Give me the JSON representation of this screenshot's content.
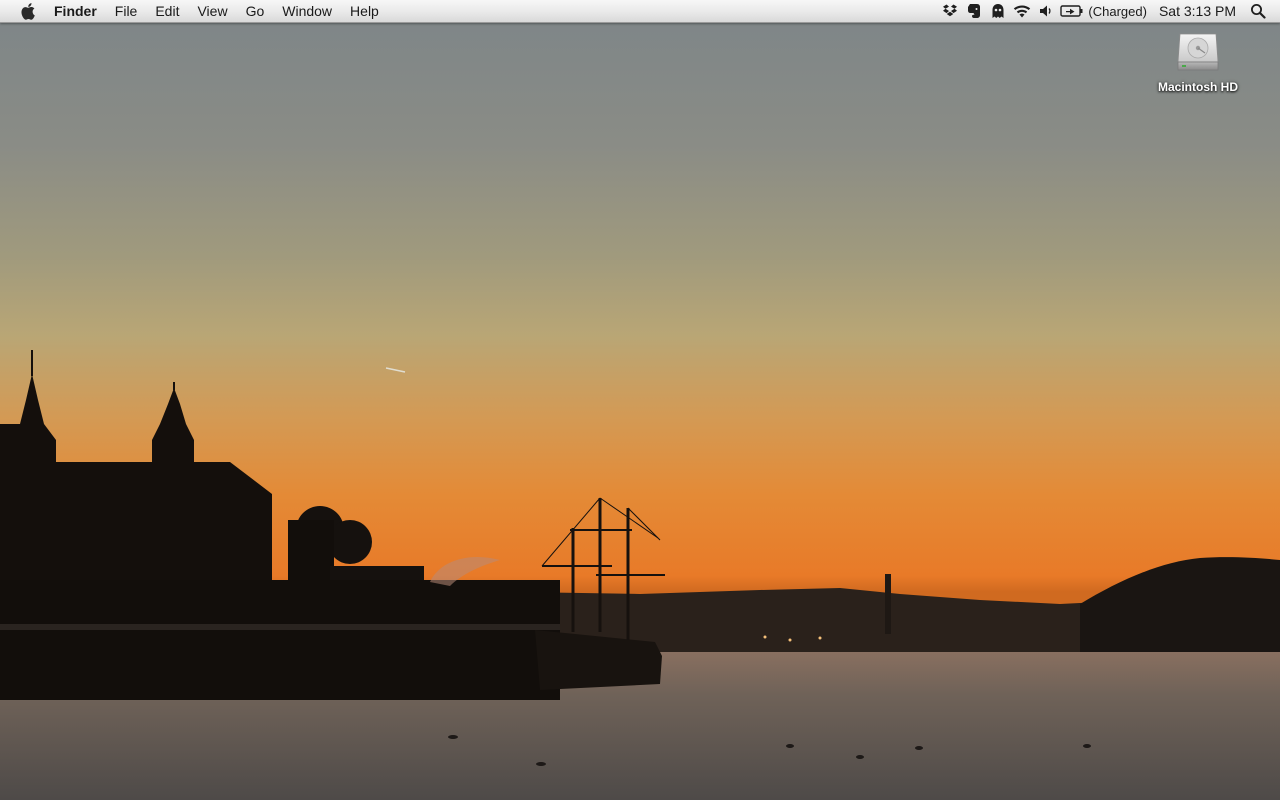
{
  "menubar": {
    "apple_icon": "apple-logo-icon",
    "app_name": "Finder",
    "menus": [
      "File",
      "Edit",
      "View",
      "Go",
      "Window",
      "Help"
    ],
    "status_icons": [
      "dropbox-icon",
      "evernote-icon",
      "ghost-icon",
      "wifi-icon",
      "volume-icon",
      "battery-icon"
    ],
    "battery_status": "(Charged)",
    "clock": "Sat 3:13 PM",
    "spotlight_icon": "search-icon"
  },
  "desktop": {
    "icons": [
      {
        "label": "Macintosh HD",
        "icon": "hard-drive-icon"
      }
    ]
  },
  "colors": {
    "sky_top": "#7d8588",
    "sunset_orange": "#e87a28",
    "silhouette": "#1b1410",
    "water": "#6e6157"
  }
}
